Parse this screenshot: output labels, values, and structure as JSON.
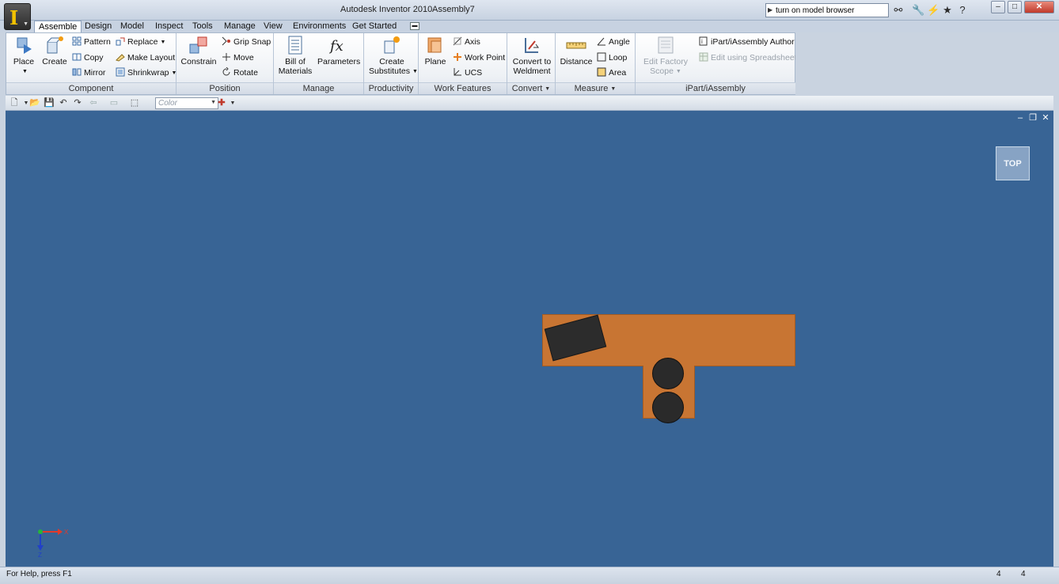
{
  "window": {
    "app_title": "Autodesk Inventor 2010",
    "document_title": "Assembly7",
    "search_value": "turn on model browser",
    "minimize": "–",
    "maximize": "□",
    "close": "✕"
  },
  "tabs": [
    "Assemble",
    "Design",
    "Model",
    "Inspect",
    "Tools",
    "Manage",
    "View",
    "Environments",
    "Get Started"
  ],
  "ribbon": {
    "component": {
      "title": "Component",
      "place": "Place",
      "create": "Create",
      "pattern": "Pattern",
      "copy": "Copy",
      "mirror": "Mirror",
      "replace": "Replace",
      "make_layout": "Make Layout",
      "shrinkwrap": "Shrinkwrap"
    },
    "position": {
      "title": "Position",
      "constrain": "Constrain",
      "grip_snap": "Grip Snap",
      "move": "Move",
      "rotate": "Rotate"
    },
    "manage": {
      "title": "Manage",
      "bom_line1": "Bill of",
      "bom_line2": "Materials",
      "parameters": "Parameters"
    },
    "productivity": {
      "title": "Productivity",
      "create_sub_line1": "Create",
      "create_sub_line2": "Substitutes"
    },
    "work_features": {
      "title": "Work Features",
      "plane": "Plane",
      "axis": "Axis",
      "work_point": "Work Point",
      "ucs": "UCS"
    },
    "convert": {
      "title": "Convert",
      "convert_line1": "Convert to",
      "convert_line2": "Weldment"
    },
    "measure": {
      "title": "Measure",
      "distance": "Distance",
      "angle": "Angle",
      "loop": "Loop",
      "area": "Area"
    },
    "ipart": {
      "title": "iPart/iAssembly",
      "edit_factory_line1": "Edit Factory",
      "edit_factory_line2": "Scope",
      "author": "iPart/iAssembly Author",
      "edit_spreadsheet": "Edit using Spreadsheet"
    }
  },
  "qat": {
    "color_placeholder": "Color"
  },
  "viewport": {
    "viewcube_label": "TOP",
    "triad_x": "X",
    "triad_z": "Z",
    "background_color": "#386495",
    "part_color": "#c87533"
  },
  "status": {
    "help_text": "For Help, press F1",
    "count1": "4",
    "count2": "4"
  }
}
